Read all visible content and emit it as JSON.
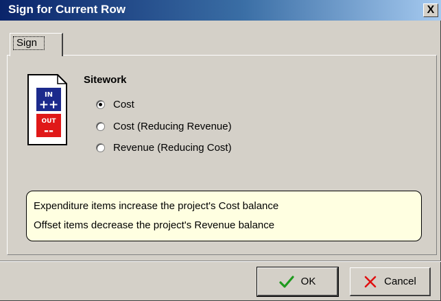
{
  "window": {
    "title": "Sign for Current Row",
    "close_glyph": "X"
  },
  "tabs": [
    {
      "label": "Sign",
      "selected": true
    }
  ],
  "sign_icon": {
    "icon": "in-out-sign-icon",
    "top_text": "IN",
    "top_symbols": "++",
    "bottom_text": "OUT",
    "bottom_symbols": "--",
    "top_color": "#1c2a8c",
    "bottom_color": "#e01818"
  },
  "group": {
    "title": "Sitework",
    "options": [
      {
        "label": "Cost",
        "checked": true
      },
      {
        "label": "Cost (Reducing Revenue)",
        "checked": false
      },
      {
        "label": "Revenue (Reducing Cost)",
        "checked": false
      }
    ]
  },
  "info": {
    "line1": "Expenditure items increase the project's Cost balance",
    "line2": "Offset items decrease the project's Revenue balance"
  },
  "buttons": {
    "ok": {
      "label": "OK",
      "icon": "checkmark-icon",
      "color": "#1e9a1e"
    },
    "cancel": {
      "label": "Cancel",
      "icon": "x-icon",
      "color": "#e01010"
    }
  }
}
